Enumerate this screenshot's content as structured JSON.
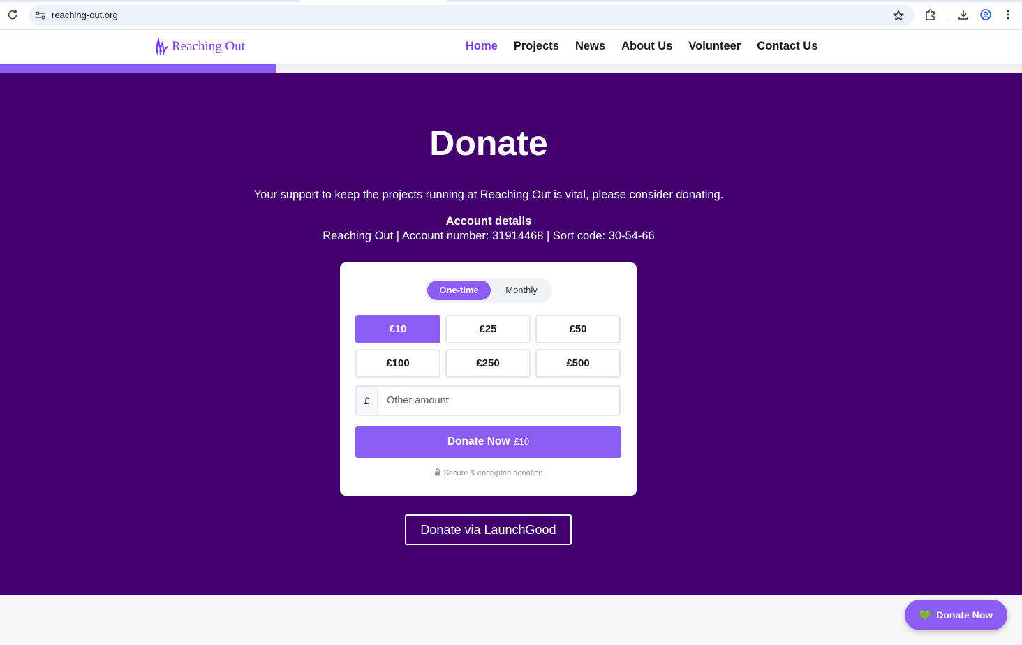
{
  "browser": {
    "url": "reaching-out.org"
  },
  "header": {
    "logo_text": "Reaching Out",
    "nav": [
      {
        "label": "Home",
        "active": true
      },
      {
        "label": "Projects"
      },
      {
        "label": "News"
      },
      {
        "label": "About Us"
      },
      {
        "label": "Volunteer"
      },
      {
        "label": "Contact Us"
      }
    ],
    "scroll_progress": 0.27
  },
  "hero": {
    "title": "Donate",
    "subtitle": "Your support to keep the projects running at Reaching Out is vital, please consider donating.",
    "account_heading": "Account details",
    "account_line": "Reaching Out | Account number: 31914468 | Sort code: 30-54-66"
  },
  "donation": {
    "frequency": {
      "options": [
        "One-time",
        "Monthly"
      ],
      "selected": "One-time"
    },
    "amounts": [
      "£10",
      "£25",
      "£50",
      "£100",
      "£250",
      "£500"
    ],
    "selected_amount": "£10",
    "other": {
      "currency_symbol": "£",
      "placeholder": "Other amount"
    },
    "donate_button": {
      "label": "Donate Now",
      "amount": "£10"
    },
    "secure_note": "Secure & encrypted donation"
  },
  "launchgood_button": "Donate via LaunchGood",
  "floating_button": {
    "label": "Donate Now"
  },
  "colors": {
    "brand": "#8b5cf6",
    "hero_bg": "#41006d",
    "heart": "#3ccf5a"
  }
}
